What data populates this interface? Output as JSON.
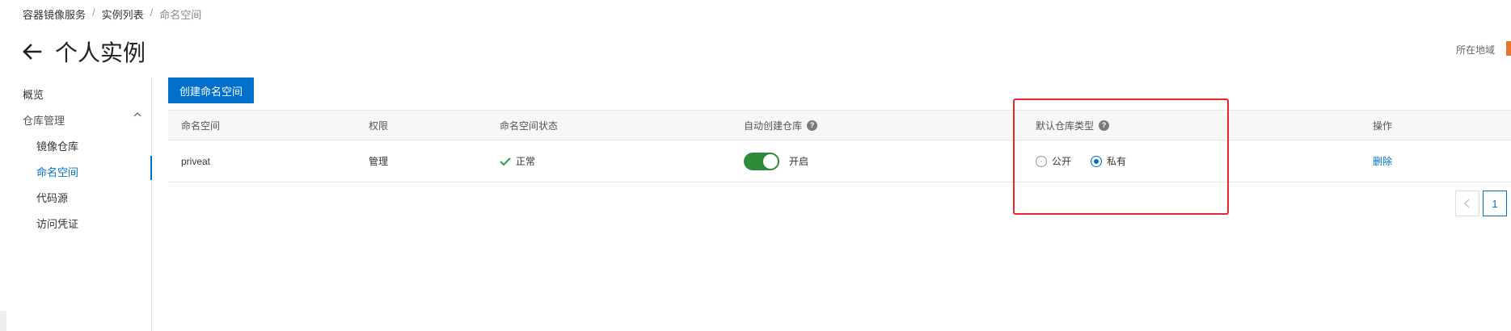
{
  "breadcrumb": [
    "容器镜像服务",
    "实例列表",
    "命名空间"
  ],
  "breadcrumb_sep": "/",
  "page_title": "个人实例",
  "region_label": "所在地域",
  "sidebar": {
    "items": [
      {
        "label": "概览"
      },
      {
        "label": "仓库管理"
      },
      {
        "label": "镜像仓库"
      },
      {
        "label": "命名空间"
      },
      {
        "label": "代码源"
      },
      {
        "label": "访问凭证"
      }
    ]
  },
  "create_button": "创建命名空间",
  "table": {
    "headers": {
      "namespace": "命名空间",
      "permission": "权限",
      "status": "命名空间状态",
      "auto_create": "自动创建仓库",
      "default_type": "默认仓库类型",
      "action": "操作"
    },
    "rows": [
      {
        "namespace": "priveat",
        "permission": "管理",
        "status": "正常",
        "auto_create": "开启",
        "radio_public": "公开",
        "radio_private": "私有",
        "selected": "private",
        "action": "删除"
      }
    ]
  },
  "pagination": {
    "current": "1"
  },
  "colors": {
    "primary": "#0070cc",
    "toggle_on": "#2e8b3a",
    "highlight": "#e8262c",
    "success": "#2e9b4a"
  }
}
